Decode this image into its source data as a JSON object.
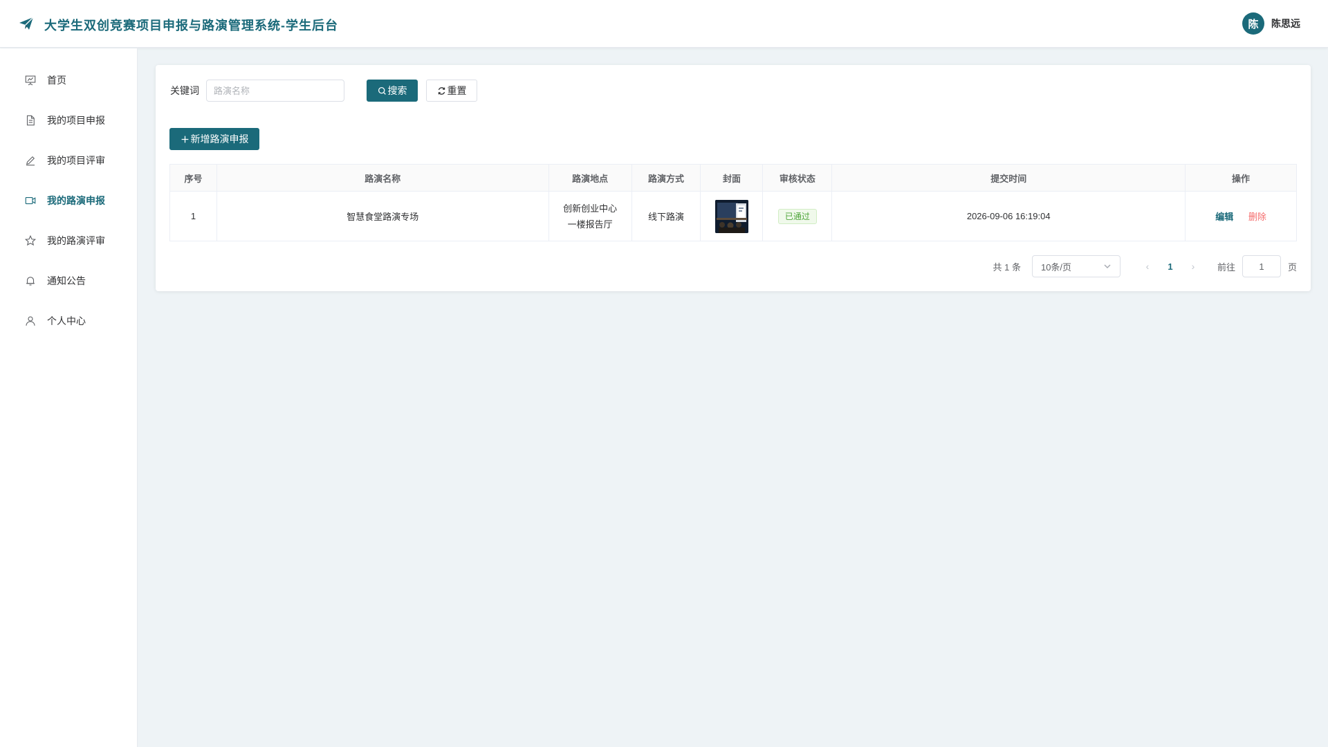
{
  "header": {
    "title": "大学生双创竞赛项目申报与路演管理系统-学生后台",
    "avatar_initial": "陈",
    "username": "陈思远"
  },
  "sidebar": {
    "items": [
      {
        "label": "首页",
        "icon": "presentation-icon",
        "active": false
      },
      {
        "label": "我的项目申报",
        "icon": "document-icon",
        "active": false
      },
      {
        "label": "我的项目评审",
        "icon": "pen-icon",
        "active": false
      },
      {
        "label": "我的路演申报",
        "icon": "video-camera-icon",
        "active": true
      },
      {
        "label": "我的路演评审",
        "icon": "star-icon",
        "active": false
      },
      {
        "label": "通知公告",
        "icon": "bell-icon",
        "active": false
      },
      {
        "label": "个人中心",
        "icon": "user-icon",
        "active": false
      }
    ]
  },
  "search": {
    "label": "关键词",
    "placeholder": "路演名称",
    "value": "",
    "search_button": "搜索",
    "reset_button": "重置"
  },
  "add_button": "新增路演申报",
  "table": {
    "columns": [
      "序号",
      "路演名称",
      "路演地点",
      "路演方式",
      "封面",
      "审核状态",
      "提交时间",
      "操作"
    ],
    "rows": [
      {
        "index": "1",
        "name": "智慧食堂路演专场",
        "location": "创新创业中心\n一楼报告厅",
        "mode": "线下路演",
        "status": "已通过",
        "submit_time": "2026-09-06 16:19:04",
        "actions": {
          "edit": "编辑",
          "delete": "删除"
        }
      }
    ]
  },
  "pagination": {
    "total_text": "共 1 条",
    "page_size": "10条/页",
    "current_page": "1",
    "goto_label": "前往",
    "goto_value": "1",
    "goto_suffix": "页"
  },
  "colors": {
    "primary": "#1b6a7a",
    "success": "#4ea53a",
    "danger": "#f56c6c",
    "background": "#eef3f6"
  }
}
